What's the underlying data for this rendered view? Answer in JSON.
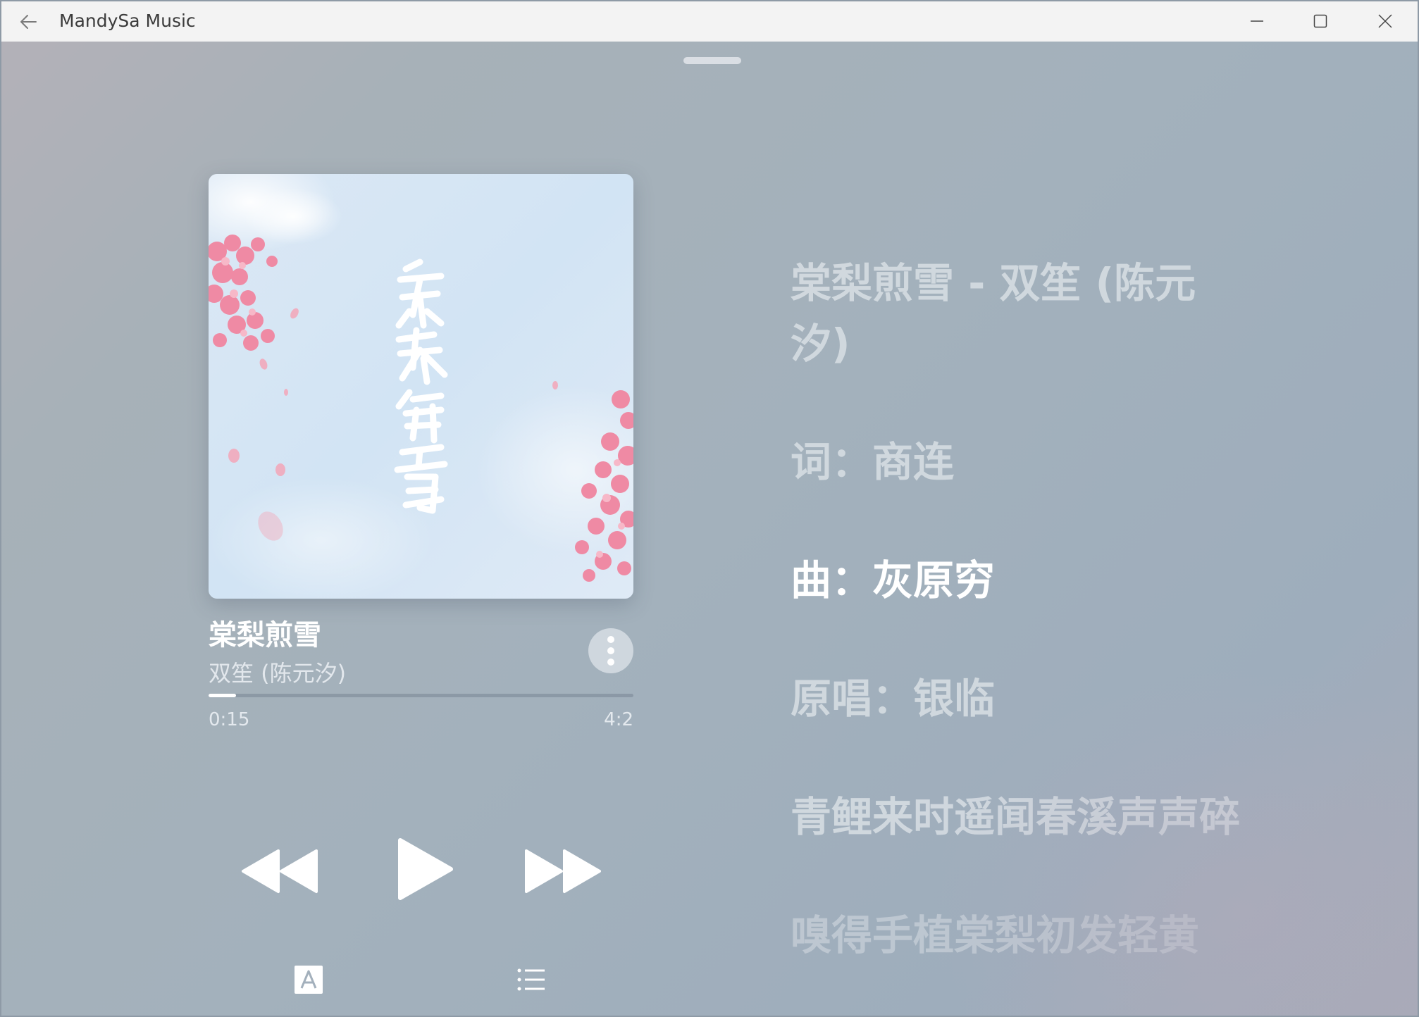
{
  "window": {
    "title": "MandySa Music"
  },
  "song": {
    "title": "棠梨煎雪",
    "artist": "双笙 (陈元汐)"
  },
  "progress": {
    "current": "0:15",
    "total": "4:2",
    "fraction": 0.065
  },
  "lyrics": [
    {
      "text": "棠梨煎雪 - 双笙 (陈元汐)",
      "state": "normal"
    },
    {
      "text": "词：商连",
      "state": "normal"
    },
    {
      "text": "曲：灰原穷",
      "state": "active"
    },
    {
      "text": "原唱：银临",
      "state": "normal"
    },
    {
      "text": "青鲤来时遥闻春溪声声碎",
      "state": "normal"
    },
    {
      "text": "嗅得手植棠梨初发轻黄",
      "state": "fade"
    }
  ],
  "icons": {
    "back": "back-arrow-icon",
    "minimize": "minimize-icon",
    "maximize": "maximize-icon",
    "close": "close-icon",
    "more": "more-vertical-icon",
    "previous": "previous-icon",
    "play": "play-icon",
    "next": "next-icon",
    "lyrics": "lyrics-toggle-icon",
    "playlist": "playlist-icon"
  },
  "colors": {
    "titlebar": "#f3f3f3",
    "accent_text": "#ffffff",
    "background": "#a3b1bc"
  }
}
